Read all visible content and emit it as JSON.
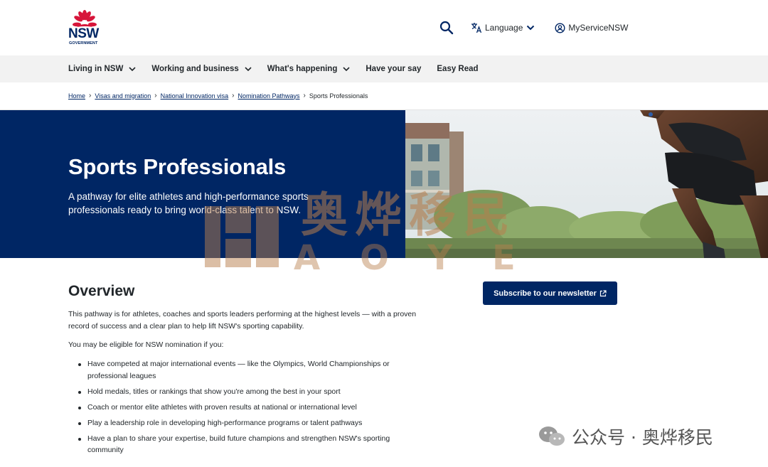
{
  "header": {
    "logo_text": "NSW",
    "logo_subtext": "GOVERNMENT",
    "search_icon": "search-icon",
    "language_label": "Language",
    "myservice_label": "MyServiceNSW"
  },
  "nav": {
    "items": [
      {
        "label": "Living in NSW",
        "has_dropdown": true
      },
      {
        "label": "Working and business",
        "has_dropdown": true
      },
      {
        "label": "What's happening",
        "has_dropdown": true
      },
      {
        "label": "Have your say",
        "has_dropdown": false
      },
      {
        "label": "Easy Read",
        "has_dropdown": false
      }
    ]
  },
  "breadcrumb": {
    "items": [
      "Home",
      "Visas and migration",
      "National Innovation visa",
      "Nomination Pathways"
    ],
    "current": "Sports Professionals"
  },
  "hero": {
    "title": "Sports Professionals",
    "subtitle": "A pathway for elite athletes and high-performance sports professionals ready to bring world-class talent to NSW."
  },
  "content": {
    "overview_title": "Overview",
    "paragraph_1": "This pathway is for athletes, coaches and sports leaders performing at the highest levels — with a proven record of success and a clear plan to help lift NSW's sporting capability.",
    "paragraph_2": "You may be eligible for NSW nomination if you:",
    "bullets": [
      "Have competed at major international events — like the Olympics, World Championships or professional leagues",
      "Hold medals, titles or rankings that show you're among the best in your sport",
      "Coach or mentor elite athletes with proven results at national or international level",
      "Play a leadership role in developing high-performance programs or talent pathways",
      "Have a plan to share your expertise, build future champions and strengthen NSW's sporting community"
    ]
  },
  "subscribe": {
    "label": "Subscribe to our newsletter"
  },
  "watermark": {
    "cn": "奥烨移民",
    "en": "AOYE",
    "wechat": "公众号 · 奥烨移民"
  },
  "colors": {
    "brand_navy": "#002664",
    "waratah_red": "#d7153a",
    "nav_bg": "#f2f2f2",
    "watermark": "#b87e4c"
  }
}
